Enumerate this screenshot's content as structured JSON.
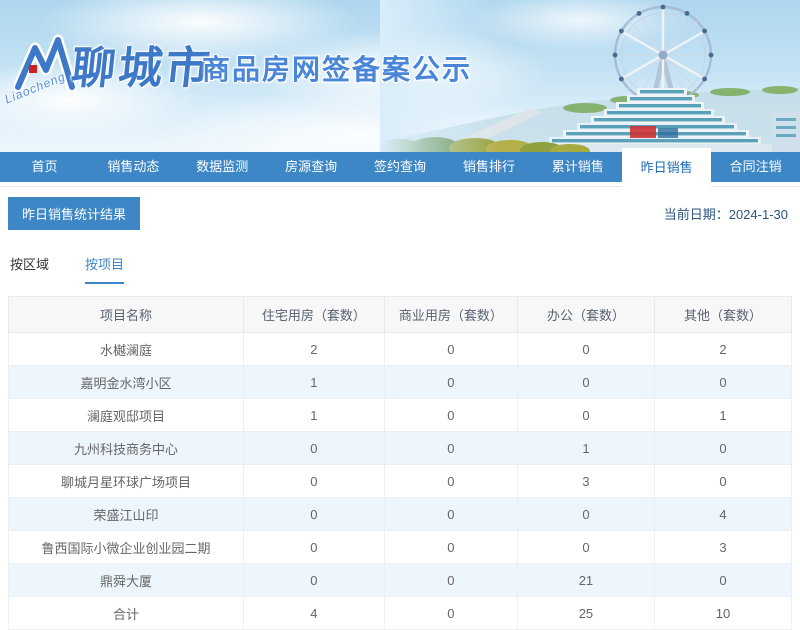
{
  "banner": {
    "brand_en": "Liaocheng",
    "brand_cn": "聊城市",
    "site_title": "商品房网签备案公示"
  },
  "nav": {
    "items": [
      {
        "name": "home",
        "label": "首页",
        "active": false
      },
      {
        "name": "sales-dynamics",
        "label": "销售动态",
        "active": false
      },
      {
        "name": "data-monitor",
        "label": "数据监测",
        "active": false
      },
      {
        "name": "listing-query",
        "label": "房源查询",
        "active": false
      },
      {
        "name": "signing-query",
        "label": "签约查询",
        "active": false
      },
      {
        "name": "sales-ranking",
        "label": "销售排行",
        "active": false
      },
      {
        "name": "cumulative-sales",
        "label": "累计销售",
        "active": false
      },
      {
        "name": "yesterday-sales",
        "label": "昨日销售",
        "active": true
      },
      {
        "name": "contract-cancellation",
        "label": "合同注销",
        "active": false
      }
    ]
  },
  "page": {
    "section_title": "昨日销售统计结果",
    "date_label": "当前日期：",
    "date_value": "2024-1-30"
  },
  "tabs": [
    {
      "name": "by-region",
      "label": "按区域",
      "active": false
    },
    {
      "name": "by-project",
      "label": "按项目",
      "active": true
    }
  ],
  "table": {
    "columns": [
      "项目名称",
      "住宅用房（套数）",
      "商业用房（套数）",
      "办公（套数）",
      "其他（套数）"
    ],
    "rows": [
      {
        "name": "水樾澜庭",
        "values": [
          "2",
          "0",
          "0",
          "2"
        ]
      },
      {
        "name": "嘉明金水湾小区",
        "values": [
          "1",
          "0",
          "0",
          "0"
        ]
      },
      {
        "name": "澜庭观邸项目",
        "values": [
          "1",
          "0",
          "0",
          "1"
        ]
      },
      {
        "name": "九州科技商务中心",
        "values": [
          "0",
          "0",
          "1",
          "0"
        ]
      },
      {
        "name": "聊城月星环球广场项目",
        "values": [
          "0",
          "0",
          "3",
          "0"
        ]
      },
      {
        "name": "荣盛江山印",
        "values": [
          "0",
          "0",
          "0",
          "4"
        ]
      },
      {
        "name": "鲁西国际小微企业创业园二期",
        "values": [
          "0",
          "0",
          "0",
          "3"
        ]
      },
      {
        "name": "鼎舜大厦",
        "values": [
          "0",
          "0",
          "21",
          "0"
        ]
      },
      {
        "name": "合计",
        "values": [
          "4",
          "0",
          "25",
          "10"
        ]
      }
    ]
  },
  "colors": {
    "nav_bg": "#3d87c6",
    "accent_blue": "#3d87c6",
    "active_tab_text": "#1e6db6",
    "stripe_blue": "#eef6fd",
    "header_gray": "#f7f7f7",
    "logo_red": "#cc2222",
    "title_blue": "#3e78c8"
  }
}
